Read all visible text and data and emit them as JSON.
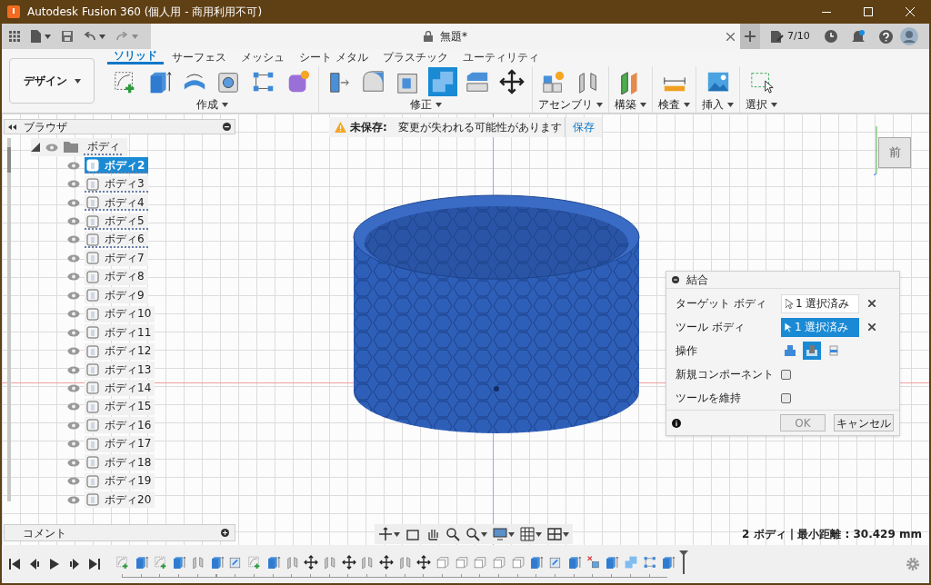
{
  "window": {
    "title": "Autodesk Fusion 360 (個人用 - 商用利用不可)"
  },
  "document_tab": {
    "title": "無題*"
  },
  "header": {
    "file_count": "7/10"
  },
  "workspace": {
    "label": "デザイン"
  },
  "ribbon_tabs": [
    {
      "label": "ソリッド",
      "selected": true
    },
    {
      "label": "サーフェス",
      "selected": false
    },
    {
      "label": "メッシュ",
      "selected": false
    },
    {
      "label": "シート メタル",
      "selected": false
    },
    {
      "label": "プラスチック",
      "selected": false
    },
    {
      "label": "ユーティリティ",
      "selected": false
    }
  ],
  "ribbon_groups": [
    {
      "label": "作成",
      "tools": [
        {
          "kind": "sketch",
          "selected": false
        },
        {
          "kind": "extrude",
          "selected": false
        },
        {
          "kind": "revolve",
          "selected": false
        },
        {
          "kind": "hole",
          "selected": false
        },
        {
          "kind": "pattern",
          "selected": false
        },
        {
          "kind": "form",
          "selected": false
        }
      ]
    },
    {
      "label": "修正",
      "tools": [
        {
          "kind": "presspull",
          "selected": false
        },
        {
          "kind": "fillet",
          "selected": false
        },
        {
          "kind": "shell",
          "selected": false
        },
        {
          "kind": "combine",
          "selected": true
        },
        {
          "kind": "split",
          "selected": false
        },
        {
          "kind": "move",
          "selected": false
        }
      ]
    },
    {
      "label": "アセンブリ",
      "tools": [
        {
          "kind": "component",
          "selected": false
        },
        {
          "kind": "joint",
          "selected": false
        }
      ]
    },
    {
      "label": "構築",
      "tools": [
        {
          "kind": "plane",
          "selected": false
        }
      ]
    },
    {
      "label": "検査",
      "tools": [
        {
          "kind": "measure",
          "selected": false
        }
      ]
    },
    {
      "label": "挿入",
      "tools": [
        {
          "kind": "image",
          "selected": false
        }
      ]
    },
    {
      "label": "選択",
      "tools": [
        {
          "kind": "select",
          "selected": false
        }
      ]
    }
  ],
  "banner": {
    "label": "未保存:",
    "message": "変更が失われる可能性があります",
    "action": "保存"
  },
  "browser": {
    "title": "ブラウザ",
    "root": {
      "label": "ボディ",
      "expanded": true,
      "underlined": true,
      "children": [
        {
          "label": "ボディ2",
          "selected": true,
          "underlined": true
        },
        {
          "label": "ボディ3",
          "selected": false,
          "underlined": true
        },
        {
          "label": "ボディ4",
          "selected": false,
          "underlined": true
        },
        {
          "label": "ボディ5",
          "selected": false,
          "underlined": true
        },
        {
          "label": "ボディ6",
          "selected": false,
          "underlined": true
        },
        {
          "label": "ボディ7",
          "selected": false,
          "underlined": false
        },
        {
          "label": "ボディ8",
          "selected": false,
          "underlined": false
        },
        {
          "label": "ボディ9",
          "selected": false,
          "underlined": false
        },
        {
          "label": "ボディ10",
          "selected": false,
          "underlined": false
        },
        {
          "label": "ボディ11",
          "selected": false,
          "underlined": false
        },
        {
          "label": "ボディ12",
          "selected": false,
          "underlined": false
        },
        {
          "label": "ボディ13",
          "selected": false,
          "underlined": false
        },
        {
          "label": "ボディ14",
          "selected": false,
          "underlined": false
        },
        {
          "label": "ボディ15",
          "selected": false,
          "underlined": false
        },
        {
          "label": "ボディ16",
          "selected": false,
          "underlined": false
        },
        {
          "label": "ボディ17",
          "selected": false,
          "underlined": false
        },
        {
          "label": "ボディ18",
          "selected": false,
          "underlined": false
        },
        {
          "label": "ボディ19",
          "selected": false,
          "underlined": false
        },
        {
          "label": "ボディ20",
          "selected": false,
          "underlined": false
        }
      ]
    }
  },
  "comments": {
    "title": "コメント"
  },
  "view_cube": {
    "face": "前"
  },
  "dialog": {
    "title": "結合",
    "rows": [
      {
        "kind": "selection",
        "label": "ターゲット ボディ",
        "value": "1 選択済み",
        "active": false
      },
      {
        "kind": "selection",
        "label": "ツール ボディ",
        "value": "1 選択済み",
        "active": true
      },
      {
        "kind": "operation",
        "label": "操作",
        "options": [
          {
            "selected": false
          },
          {
            "selected": true
          },
          {
            "selected": false
          }
        ]
      },
      {
        "kind": "checkbox",
        "label": "新規コンポーネント",
        "checked": false
      },
      {
        "kind": "checkbox",
        "label": "ツールを維持",
        "checked": false
      }
    ],
    "buttons": [
      "OK",
      "キャンセル"
    ]
  },
  "status": "2 ボディ | 最小距離 : 30.429 mm",
  "timeline": {
    "features": [
      {
        "kind": "sketch"
      },
      {
        "kind": "extrude"
      },
      {
        "kind": "sketch"
      },
      {
        "kind": "extrude"
      },
      {
        "kind": "joint"
      },
      {
        "kind": "extrude"
      },
      {
        "kind": "facesketch"
      },
      {
        "kind": "sketch"
      },
      {
        "kind": "extrude"
      },
      {
        "kind": "joint"
      },
      {
        "kind": "move"
      },
      {
        "kind": "joint"
      },
      {
        "kind": "move"
      },
      {
        "kind": "joint"
      },
      {
        "kind": "move"
      },
      {
        "kind": "joint"
      },
      {
        "kind": "move"
      },
      {
        "kind": "box"
      },
      {
        "kind": "box"
      },
      {
        "kind": "box"
      },
      {
        "kind": "box"
      },
      {
        "kind": "box"
      },
      {
        "kind": "extrude"
      },
      {
        "kind": "facesketch"
      },
      {
        "kind": "extrude"
      },
      {
        "kind": "delete"
      },
      {
        "kind": "extrude"
      },
      {
        "kind": "combine"
      },
      {
        "kind": "pattern"
      },
      {
        "kind": "extrude"
      }
    ]
  }
}
